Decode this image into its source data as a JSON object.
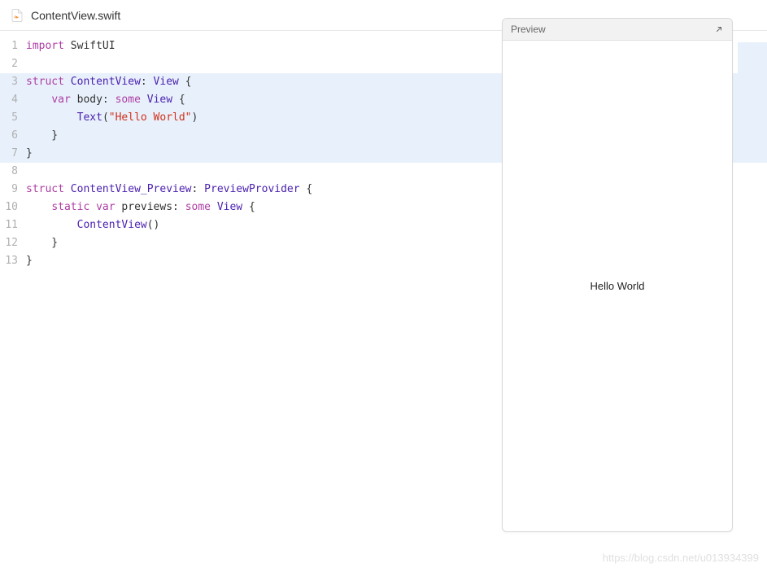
{
  "header": {
    "file_name": "ContentView.swift"
  },
  "editor": {
    "lines": [
      {
        "num": "1",
        "hl": false,
        "segs": [
          {
            "c": "kw-import",
            "t": "import"
          },
          {
            "c": "",
            "t": " SwiftUI"
          }
        ]
      },
      {
        "num": "2",
        "hl": false,
        "segs": []
      },
      {
        "num": "3",
        "hl": true,
        "segs": [
          {
            "c": "kw-struct",
            "t": "struct"
          },
          {
            "c": "",
            "t": " "
          },
          {
            "c": "type",
            "t": "ContentView"
          },
          {
            "c": "",
            "t": ": "
          },
          {
            "c": "type",
            "t": "View"
          },
          {
            "c": "",
            "t": " {"
          }
        ]
      },
      {
        "num": "4",
        "hl": true,
        "segs": [
          {
            "c": "",
            "t": "    "
          },
          {
            "c": "kw-var",
            "t": "var"
          },
          {
            "c": "",
            "t": " body: "
          },
          {
            "c": "kw-some",
            "t": "some"
          },
          {
            "c": "",
            "t": " "
          },
          {
            "c": "type",
            "t": "View"
          },
          {
            "c": "",
            "t": " {"
          }
        ]
      },
      {
        "num": "5",
        "hl": true,
        "segs": [
          {
            "c": "",
            "t": "        "
          },
          {
            "c": "func",
            "t": "Text"
          },
          {
            "c": "",
            "t": "("
          },
          {
            "c": "string",
            "t": "\"Hello World\""
          },
          {
            "c": "",
            "t": ")"
          }
        ]
      },
      {
        "num": "6",
        "hl": true,
        "segs": [
          {
            "c": "",
            "t": "    }"
          }
        ]
      },
      {
        "num": "7",
        "hl": true,
        "segs": [
          {
            "c": "",
            "t": "}"
          }
        ]
      },
      {
        "num": "8",
        "hl": false,
        "segs": []
      },
      {
        "num": "9",
        "hl": false,
        "segs": [
          {
            "c": "kw-struct",
            "t": "struct"
          },
          {
            "c": "",
            "t": " "
          },
          {
            "c": "type",
            "t": "ContentView_Preview"
          },
          {
            "c": "",
            "t": ": "
          },
          {
            "c": "type",
            "t": "PreviewProvider"
          },
          {
            "c": "",
            "t": " {"
          }
        ]
      },
      {
        "num": "10",
        "hl": false,
        "segs": [
          {
            "c": "",
            "t": "    "
          },
          {
            "c": "kw-static",
            "t": "static"
          },
          {
            "c": "",
            "t": " "
          },
          {
            "c": "kw-var",
            "t": "var"
          },
          {
            "c": "",
            "t": " previews: "
          },
          {
            "c": "kw-some",
            "t": "some"
          },
          {
            "c": "",
            "t": " "
          },
          {
            "c": "type",
            "t": "View"
          },
          {
            "c": "",
            "t": " {"
          }
        ]
      },
      {
        "num": "11",
        "hl": false,
        "segs": [
          {
            "c": "",
            "t": "        "
          },
          {
            "c": "func",
            "t": "ContentView"
          },
          {
            "c": "",
            "t": "()"
          }
        ]
      },
      {
        "num": "12",
        "hl": false,
        "segs": [
          {
            "c": "",
            "t": "    }"
          }
        ]
      },
      {
        "num": "13",
        "hl": false,
        "segs": [
          {
            "c": "",
            "t": "}"
          }
        ]
      }
    ]
  },
  "preview": {
    "title": "Preview",
    "content": "Hello World"
  },
  "watermark": "https://blog.csdn.net/u013934399"
}
